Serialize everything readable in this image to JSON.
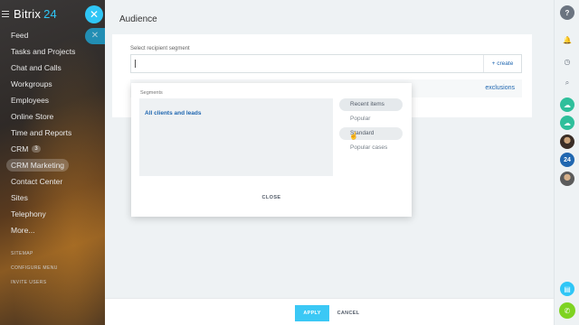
{
  "sidebar": {
    "logo_main": "Bitrix",
    "logo_num": "24",
    "items": [
      {
        "label": "Feed"
      },
      {
        "label": "Tasks and Projects"
      },
      {
        "label": "Chat and Calls"
      },
      {
        "label": "Workgroups"
      },
      {
        "label": "Employees"
      },
      {
        "label": "Online Store"
      },
      {
        "label": "Time and Reports"
      },
      {
        "label": "CRM",
        "counter": "3"
      },
      {
        "label": "CRM Marketing"
      },
      {
        "label": "Contact Center"
      },
      {
        "label": "Sites"
      },
      {
        "label": "Telephony"
      },
      {
        "label": "More..."
      }
    ],
    "sitemap": "SITEMAP",
    "configure_menu": "CONFIGURE MENU",
    "invite_users": "INVITE USERS"
  },
  "panel": {
    "title": "Audience",
    "segment_label": "Select recipient segment",
    "create_label": "+ create",
    "exclusions_label": "exclusions"
  },
  "popup": {
    "title": "Segments",
    "items": [
      "All clients and leads"
    ],
    "tabs": [
      "Recent items",
      "Popular",
      "Standard",
      "Popular cases"
    ],
    "close_label": "CLOSE"
  },
  "footer": {
    "apply_label": "APPLY",
    "cancel_label": "CANCEL"
  },
  "rail": {
    "help": "?",
    "avatar_badge": "24"
  },
  "colors": {
    "accent": "#2fc6f6",
    "link": "#2067b0",
    "apply": "#3bc8f5"
  }
}
